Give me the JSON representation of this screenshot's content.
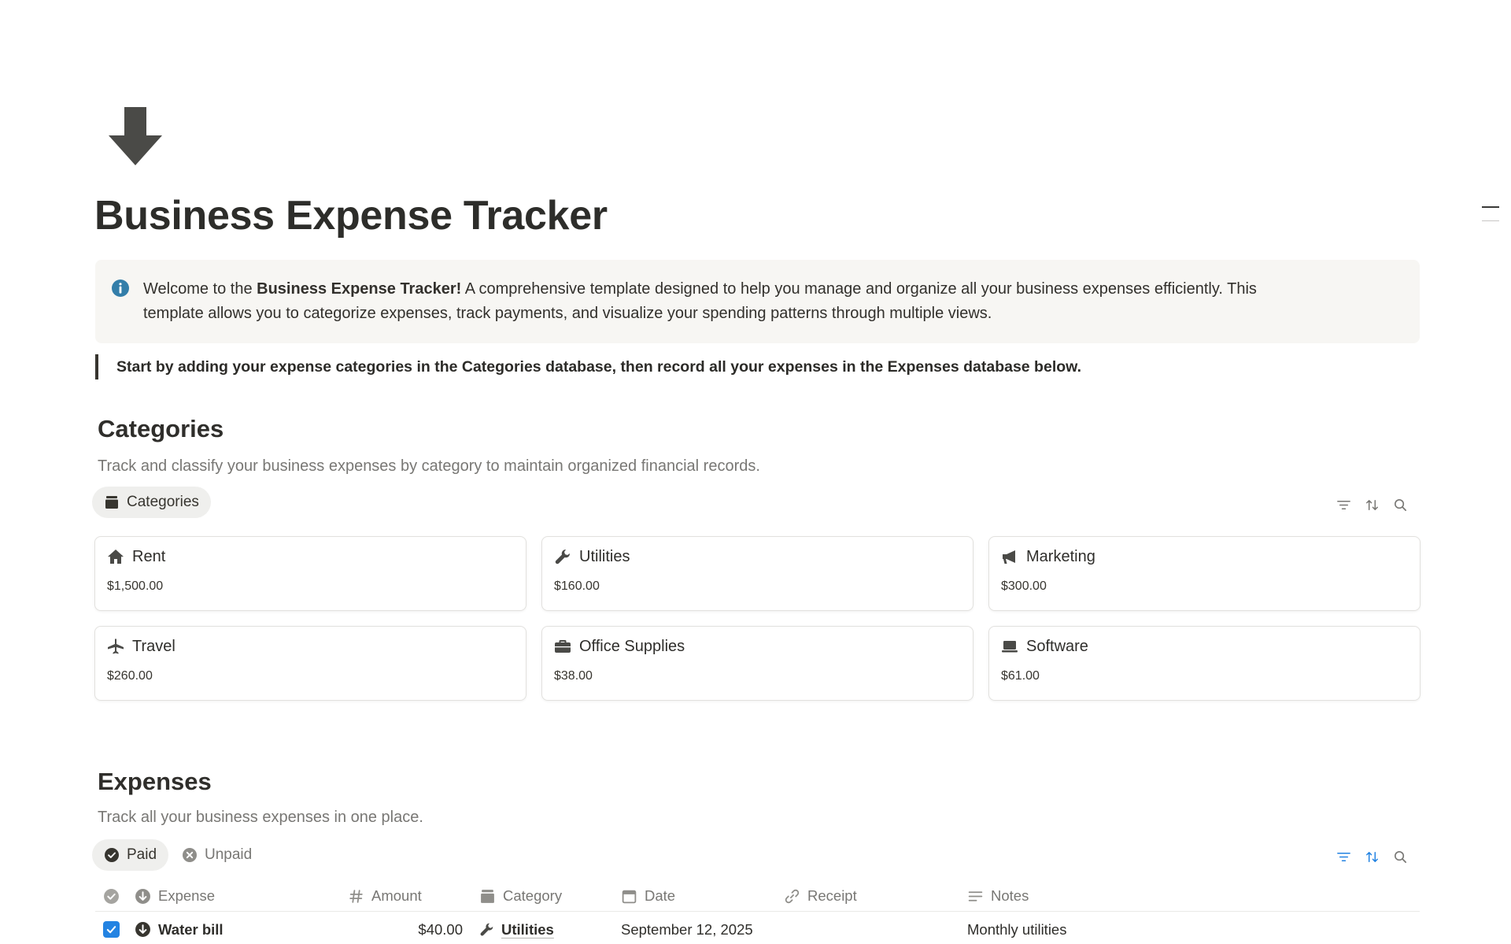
{
  "page": {
    "icon": "arrow-down-icon",
    "title": "Business Expense Tracker"
  },
  "callout": {
    "icon": "info-icon",
    "prefix": "Welcome to the ",
    "bold": "Business Expense Tracker!",
    "line1_rest": " A comprehensive template designed to help you manage and organize all your business expenses efficiently. This",
    "line2": "template allows you to categorize expenses, track payments, and visualize your spending patterns through multiple views."
  },
  "quote": "Start by adding your expense categories in the Categories database, then record all your expenses in the Expenses database below.",
  "categories_section": {
    "heading": "Categories",
    "description": "Track and classify your business expenses by category to maintain organized financial records.",
    "view_tab": {
      "label": "Categories",
      "icon": "archive-icon"
    },
    "toolbar": [
      "filter-icon",
      "sort-icon",
      "search-icon"
    ],
    "cards": [
      {
        "name": "Rent",
        "icon": "home-icon",
        "amount": "$1,500.00"
      },
      {
        "name": "Utilities",
        "icon": "wrench-icon",
        "amount": "$160.00"
      },
      {
        "name": "Marketing",
        "icon": "megaphone-icon",
        "amount": "$300.00"
      },
      {
        "name": "Travel",
        "icon": "airplane-icon",
        "amount": "$260.00"
      },
      {
        "name": "Office Supplies",
        "icon": "briefcase-icon",
        "amount": "$38.00"
      },
      {
        "name": "Software",
        "icon": "laptop-icon",
        "amount": "$61.00"
      }
    ]
  },
  "expenses_section": {
    "heading": "Expenses",
    "description": "Track all your business expenses in one place.",
    "view_tabs": [
      {
        "label": "Paid",
        "icon": "check-circle-icon",
        "active": true
      },
      {
        "label": "Unpaid",
        "icon": "x-circle-icon",
        "active": false
      }
    ],
    "toolbar": [
      "filter-icon",
      "sort-icon",
      "search-icon"
    ],
    "accent_color": "#2383e2",
    "columns": [
      {
        "label": "",
        "icon": "check-circle-icon"
      },
      {
        "label": "Expense",
        "icon": "arrow-down-circle-icon"
      },
      {
        "label": "Amount",
        "icon": "hash-icon"
      },
      {
        "label": "Category",
        "icon": "archive-icon"
      },
      {
        "label": "Date",
        "icon": "calendar-icon"
      },
      {
        "label": "Receipt",
        "icon": "link-icon"
      },
      {
        "label": "Notes",
        "icon": "text-lines-icon"
      }
    ],
    "rows": [
      {
        "paid": true,
        "expense": "Water bill",
        "amount": "$40.00",
        "category": "Utilities",
        "category_icon": "wrench-icon",
        "date": "September 12, 2025",
        "receipt": "",
        "notes": "Monthly utilities"
      }
    ]
  }
}
